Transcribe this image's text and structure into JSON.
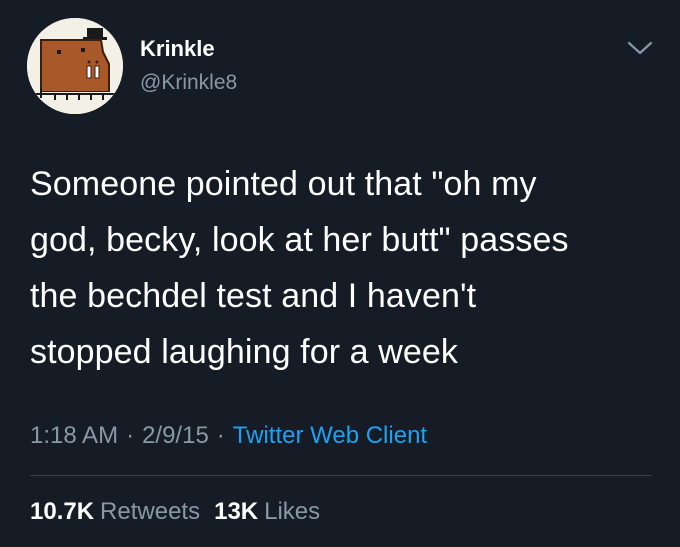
{
  "user": {
    "display_name": "Krinkle",
    "handle": "@Krinkle8",
    "avatar_icon": "walrus-cartoon-avatar"
  },
  "tweet": {
    "lines": [
      "Someone pointed out that \"oh my",
      "god, becky, look at her butt\" passes",
      "the bechdel test and I haven't",
      "stopped laughing for a week"
    ]
  },
  "meta": {
    "time": "1:18 AM",
    "date": "2/9/15",
    "separator": "·",
    "source": "Twitter Web Client"
  },
  "stats": {
    "retweets_count": "10.7K",
    "retweets_label": "Retweets",
    "likes_count": "13K",
    "likes_label": "Likes"
  },
  "colors": {
    "background": "#151c26",
    "text": "#ffffff",
    "muted": "#8899a6",
    "link": "#1da1f2",
    "divider": "#38444d"
  },
  "icons": {
    "caret": "chevron-down-icon"
  }
}
